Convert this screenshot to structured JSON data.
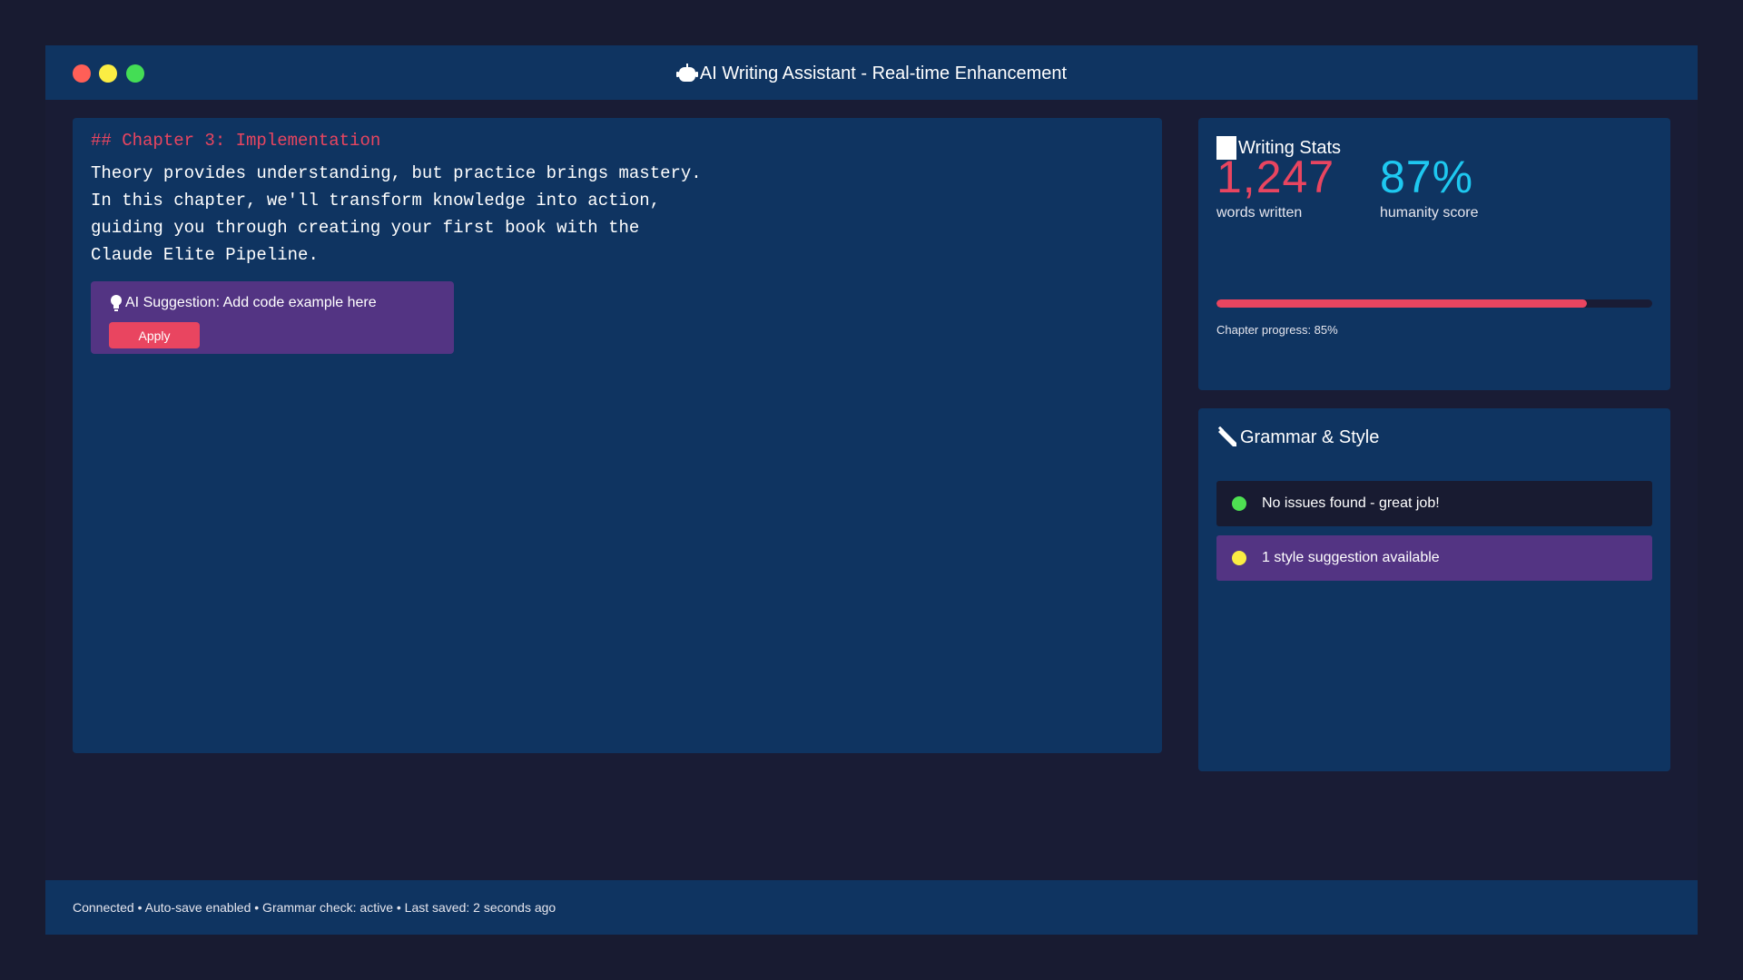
{
  "window": {
    "title": "AI Writing Assistant - Real-time Enhancement",
    "title_icon": "robot-icon"
  },
  "editor": {
    "heading": "## Chapter 3: Implementation",
    "lines": [
      "Theory provides understanding, but practice brings mastery.",
      "In this chapter, we'll transform knowledge into action,",
      "guiding you through creating your first book with the",
      "Claude Elite Pipeline."
    ],
    "suggestion": {
      "icon": "lightbulb-icon",
      "text": "AI Suggestion: Add code example here",
      "apply_label": "Apply"
    }
  },
  "stats": {
    "title": "Writing Stats",
    "icon": "chart-icon",
    "words_value": "1,247",
    "words_label": "words written",
    "humanity_value": "87%",
    "humanity_label": "humanity score",
    "progress_fraction": 0.85,
    "progress_label": "Chapter progress: 85%"
  },
  "grammar": {
    "title": "Grammar & Style",
    "icon": "pencil-icon",
    "items": [
      {
        "text": "No issues found - great job!",
        "status": "ok"
      },
      {
        "text": "1 style suggestion available",
        "status": "suggestion"
      }
    ]
  },
  "statusbar": {
    "text": "Connected • Auto-save enabled • Grammar check: active • Last saved: 2 seconds ago"
  },
  "colors": {
    "accent": "#e94560",
    "humanity": "#1ec8f0",
    "panel": "#0f3461",
    "suggestion": "#533483",
    "ok": "#4ee052",
    "warn": "#fbed43"
  }
}
